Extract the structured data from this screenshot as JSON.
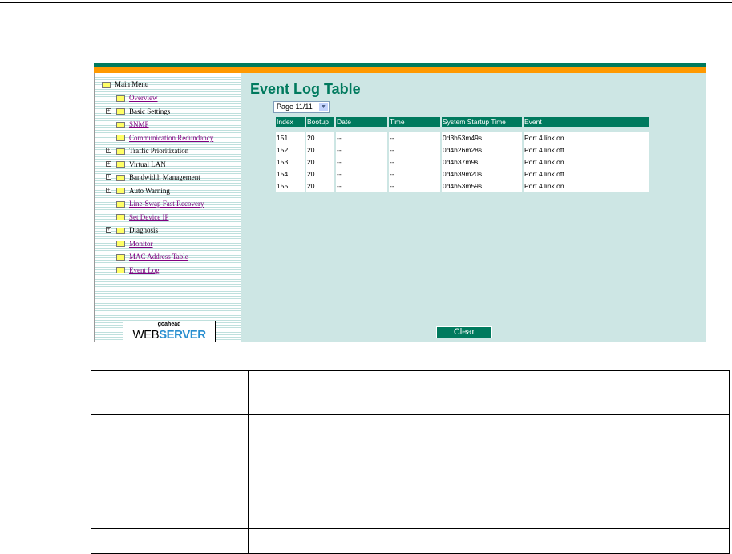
{
  "sidebar": {
    "main_menu": "Main Menu",
    "items": [
      {
        "label": "Overview",
        "link": true,
        "expand": false
      },
      {
        "label": "Basic Settings",
        "link": false,
        "expand": true
      },
      {
        "label": "SNMP",
        "link": true,
        "expand": false
      },
      {
        "label": "Communication Redundancy",
        "link": true,
        "expand": false
      },
      {
        "label": "Traffic Prioritization",
        "link": false,
        "expand": true
      },
      {
        "label": "Virtual LAN",
        "link": false,
        "expand": true
      },
      {
        "label": "Bandwidth Management",
        "link": false,
        "expand": true
      },
      {
        "label": "Auto Warning",
        "link": false,
        "expand": true
      },
      {
        "label": "Line-Swap Fast Recovery",
        "link": true,
        "expand": false
      },
      {
        "label": "Set Device IP",
        "link": true,
        "expand": false
      },
      {
        "label": "Diagnosis",
        "link": false,
        "expand": true
      },
      {
        "label": "Monitor",
        "link": true,
        "expand": false
      },
      {
        "label": "MAC Address Table",
        "link": true,
        "expand": false
      },
      {
        "label": "Event Log",
        "link": true,
        "expand": false
      }
    ],
    "logo": {
      "small": "goahead",
      "web": "WEB",
      "server": "SERVER"
    }
  },
  "main": {
    "title": "Event Log Table",
    "page_select": "Page 11/11",
    "clear_label": "Clear",
    "columns": [
      "Index",
      "Bootup",
      "Date",
      "Time",
      "System Startup Time",
      "Event"
    ],
    "rows": [
      [
        "151",
        "20",
        "--",
        "--",
        "0d3h53m49s",
        "Port 4 link on"
      ],
      [
        "152",
        "20",
        "--",
        "--",
        "0d4h26m28s",
        "Port 4 link off"
      ],
      [
        "153",
        "20",
        "--",
        "--",
        "0d4h37m9s",
        "Port 4 link on"
      ],
      [
        "154",
        "20",
        "--",
        "--",
        "0d4h39m20s",
        "Port 4 link off"
      ],
      [
        "155",
        "20",
        "--",
        "--",
        "0d4h53m59s",
        "Port 4 link on"
      ]
    ]
  },
  "colors": {
    "accent": "#007a5e",
    "orange": "#ff9900",
    "background": "#cde6e4"
  }
}
